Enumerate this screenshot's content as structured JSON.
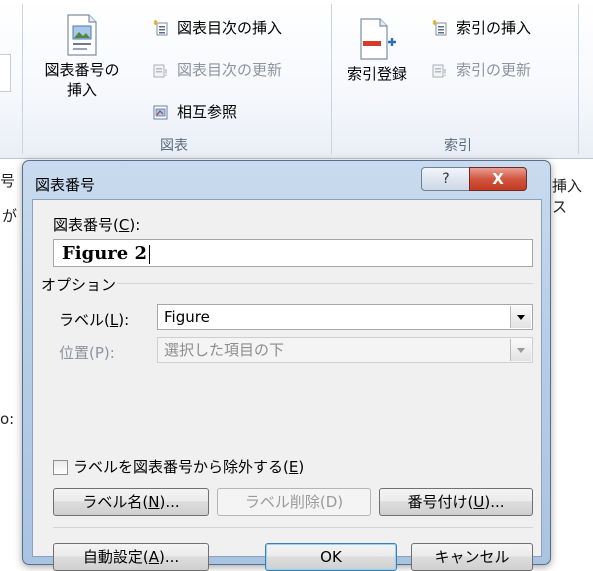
{
  "ribbon": {
    "insert_caption": {
      "line1": "図表番号の",
      "line2": "挿入"
    },
    "insert_tof": "図表目次の挿入",
    "update_tof": "図表目次の更新",
    "cross_reference": "相互参照",
    "captions_group": "図表",
    "mark_entry": "索引登録",
    "insert_index": "索引の挿入",
    "update_index": "索引の更新",
    "index_group": "索引"
  },
  "document": {
    "left_chars": [
      "号",
      "が",
      "o:"
    ],
    "right_chars": "挿入ス"
  },
  "dialog": {
    "title": "図表番号",
    "help_glyph": "?",
    "close_glyph": "X",
    "caption_label": "図表番号(",
    "caption_key": "C",
    "caption_label_end": "):",
    "caption_value": "Figure 2",
    "options_label": "オプション",
    "label_label": "ラベル(",
    "label_key": "L",
    "label_label_end": "):",
    "label_value": "Figure",
    "position_label": "位置(P):",
    "position_value": "選択した項目の下",
    "exclude_label": "ラベルを図表番号から除外する(",
    "exclude_key": "E",
    "exclude_end": ")",
    "exclude_checked": false,
    "new_label_btn": "ラベル名(",
    "new_label_key": "N",
    "new_label_end": ")...",
    "delete_label_btn": "ラベル削除(D)",
    "numbering_btn": "番号付け(",
    "numbering_key": "U",
    "numbering_end": ")...",
    "autocaption_btn": "自動設定(",
    "autocaption_key": "A",
    "autocaption_end": ")...",
    "ok_btn": "OK",
    "cancel_btn": "キャンセル"
  }
}
